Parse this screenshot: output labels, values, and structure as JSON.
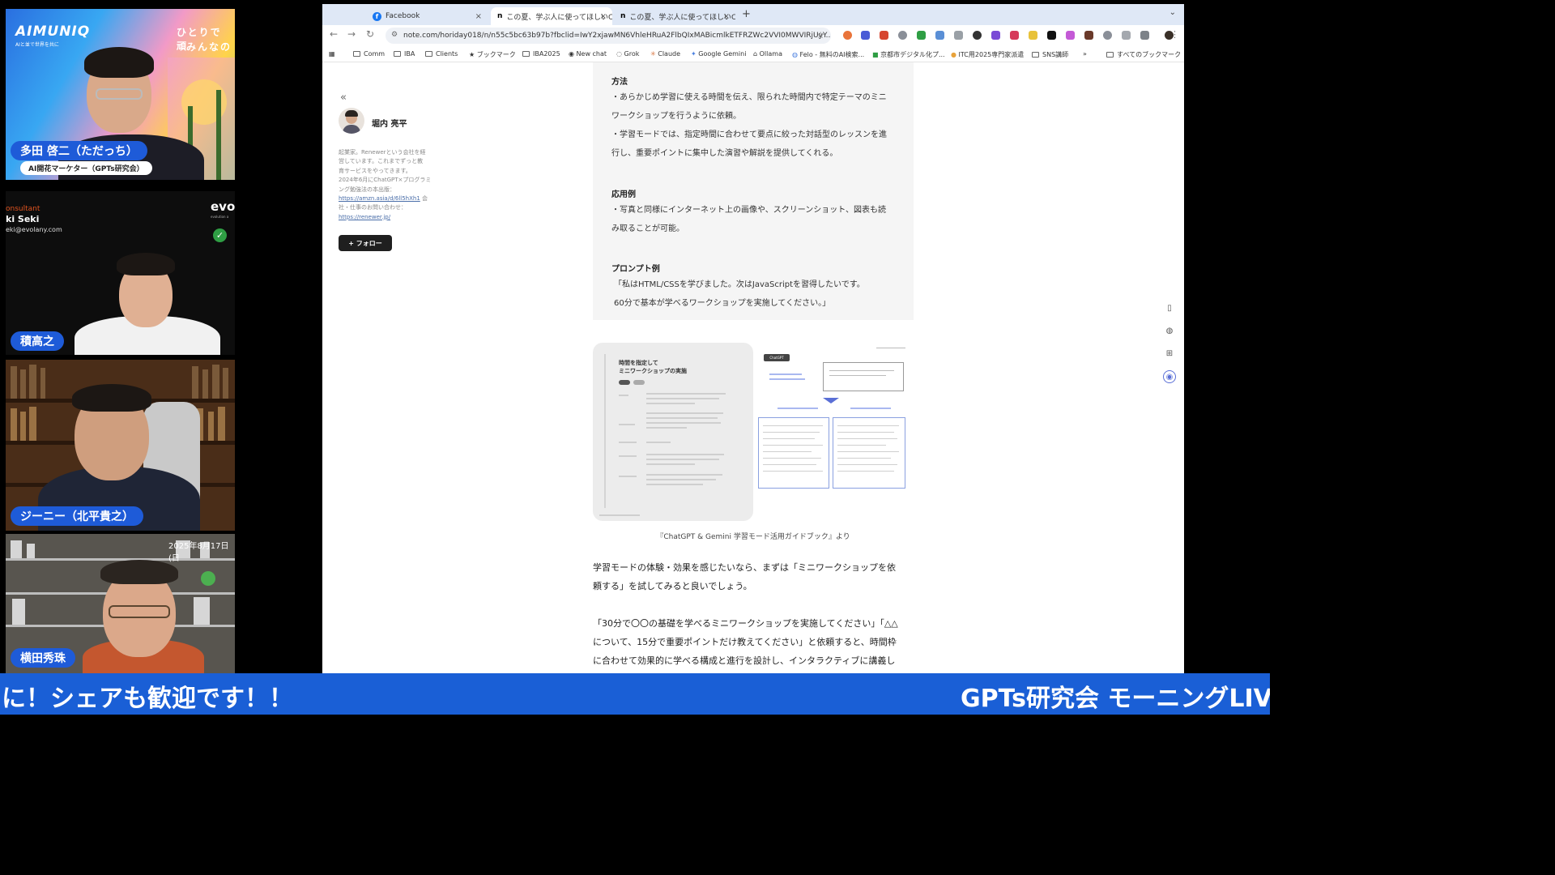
{
  "tiles": {
    "tile1": {
      "banner_brand": "AIMUNIQ",
      "banner_tagline": "AIと並で世界を共に",
      "banner_right_1": "ひとりで 頑",
      "banner_right_2": "みんなの",
      "name": "多田 啓二（ただっち）",
      "subtitle": "AI開花マーケター（GPTs研究会）"
    },
    "tile2": {
      "role": "onsultant",
      "person_name": "ki Seki",
      "email": "eki@evolany.com",
      "logo": "evo",
      "logo_sub": "evolution a",
      "name": "積高之"
    },
    "tile3": {
      "name": "ジーニー（北平貴之）"
    },
    "tile4": {
      "date": "2025年8月17日(日",
      "name": "横田秀珠"
    }
  },
  "browser": {
    "tabs": [
      {
        "label": "Facebook",
        "icon": "f",
        "active": false
      },
      {
        "label": "この夏、学ぶ人に使ってほしいC",
        "icon": "n",
        "active": true
      },
      {
        "label": "この夏、学ぶ人に使ってほしいC",
        "icon": "n",
        "active": false
      }
    ],
    "newtab": "+",
    "url": "note.com/horiday018/n/n55c5bc63b97b?fbclid=IwY2xjawMN6VhleHRuA2FlbQIxMABicmlkETFRZWc2VVI0MWVIRjUyY...",
    "bookmarks": [
      {
        "label": "Comm",
        "icon": "folder"
      },
      {
        "label": "IBA",
        "icon": "folder"
      },
      {
        "label": "Clients",
        "icon": "folder"
      },
      {
        "label": "ブックマーク",
        "icon": "star"
      },
      {
        "label": "IBA2025",
        "icon": "folder"
      },
      {
        "label": "New chat",
        "icon": "openai"
      },
      {
        "label": "Grok",
        "icon": "grok"
      },
      {
        "label": "Claude",
        "icon": "claude"
      },
      {
        "label": "Google Gemini",
        "icon": "gemini"
      },
      {
        "label": "Ollama",
        "icon": "ollama"
      },
      {
        "label": "Felo - 無料のAI検索...",
        "icon": "felo"
      },
      {
        "label": "京都市デジタル化プ...",
        "icon": "kyoto"
      },
      {
        "label": "ITC用2025専門家派遣",
        "icon": "itc"
      },
      {
        "label": "SNS講師",
        "icon": "folder"
      },
      {
        "label": "»",
        "icon": "more"
      },
      {
        "label": "すべてのブックマーク",
        "icon": "folder"
      }
    ]
  },
  "author": {
    "name": "堀内 亮平",
    "bio_1": "起業家。Renewerという会社を経",
    "bio_2": "営しています。これまでずっと教",
    "bio_3": "育サービスをやってきます。",
    "bio_4": "2024年6月にChatGPT×プログラミ",
    "bio_5": "ング勉強法の本出版：",
    "bio_link1": "https://amzn.asia/d/6ll5hXh1",
    "bio_6": "会",
    "bio_7": "社・仕事のお問い合わせ：",
    "bio_link2": "https://renewer.jp/",
    "follow_label": "+ フォロー"
  },
  "article": {
    "method_heading": "方法",
    "method_p1a": "・あらかじめ学習に使える時間を伝え、限られた時間内で特定テーマのミニ",
    "method_p1b": "ワークショップを行うように依頼。",
    "method_p2a": "・学習モードでは、指定時間に合わせて要点に絞った対話型のレッスンを進",
    "method_p2b": "行し、重要ポイントに集中した演習や解説を提供してくれる。",
    "app_heading": "応用例",
    "app_p1a": "・写真と同様にインターネット上の画像や、スクリーンショット、図表も読",
    "app_p1b": "み取ることが可能。",
    "prompt_heading": "プロンプト例",
    "prompt_a": "「私はHTML/CSSを学びました。次はJavaScriptを習得したいです。",
    "prompt_b": "60分で基本が学べるワークショップを実施してください。」",
    "figure_title_1": "時間を指定して",
    "figure_title_2": "ミニワークショップの実施",
    "figure_chip": "ChatGPT",
    "caption": "『ChatGPT & Gemini 学習モード活用ガイドブック』より",
    "body1a": "学習モードの体験・効果を感じたいなら、まずは「ミニワークショップを依",
    "body1b": "頼する」を試してみると良いでしょう。",
    "body2a": "「30分で〇〇の基礎を学べるミニワークショップを実施してください」「△△",
    "body2b": "について、15分で重要ポイントだけ教えてください」と依頼すると、時間枠",
    "body2c": "に合わせて効果的に学べる構成と進行を設計し、インタラクティブに講義し"
  },
  "ticker": {
    "left": "に！シェアも歓迎です！！",
    "right": "GPTs研究会 モーニングLIV"
  },
  "colors": {
    "ticker_bg": "#1a5fd6",
    "name_pill": "#1e5bd8",
    "tab_bar": "#dfe8f6"
  }
}
